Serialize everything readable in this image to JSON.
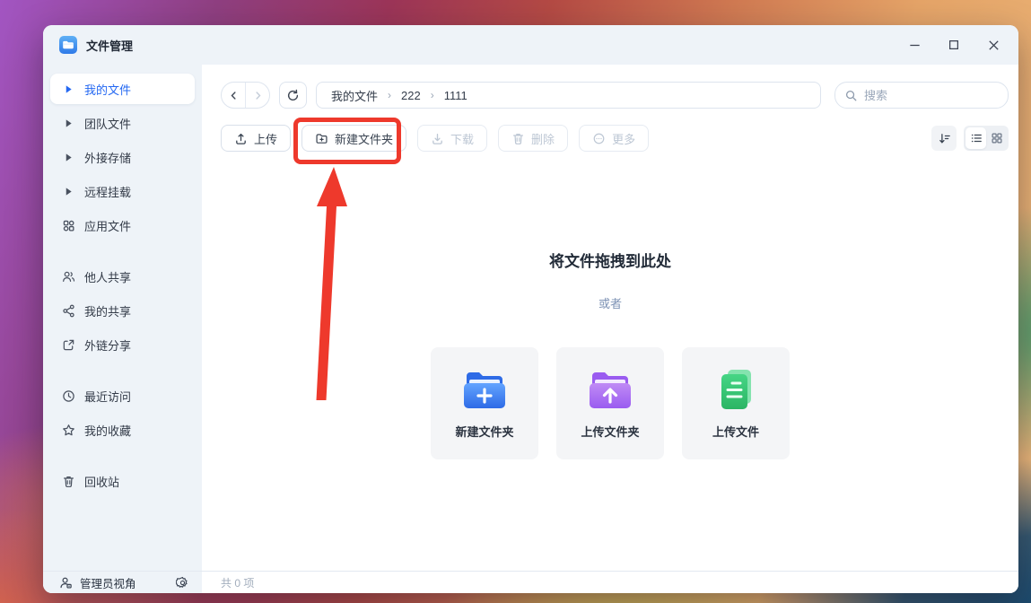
{
  "window": {
    "title": "文件管理"
  },
  "sidebar": {
    "items": [
      {
        "label": "我的文件",
        "icon": "caret-right-icon",
        "selected": true
      },
      {
        "label": "团队文件",
        "icon": "caret-right-icon",
        "selected": false
      },
      {
        "label": "外接存储",
        "icon": "caret-right-icon",
        "selected": false
      },
      {
        "label": "远程挂载",
        "icon": "caret-right-icon",
        "selected": false
      },
      {
        "label": "应用文件",
        "icon": "apps-icon",
        "selected": false
      },
      {
        "label": "他人共享",
        "icon": "shared-users-icon",
        "selected": false
      },
      {
        "label": "我的共享",
        "icon": "share-nodes-icon",
        "selected": false
      },
      {
        "label": "外链分享",
        "icon": "external-share-icon",
        "selected": false
      },
      {
        "label": "最近访问",
        "icon": "clock-icon",
        "selected": false
      },
      {
        "label": "我的收藏",
        "icon": "star-icon",
        "selected": false
      },
      {
        "label": "回收站",
        "icon": "trash-icon",
        "selected": false
      }
    ],
    "footer": {
      "label": "管理员视角",
      "icon": "admin-user-icon",
      "settings_icon": "gear-icon"
    }
  },
  "toolbar": {
    "breadcrumb": {
      "items": [
        "我的文件",
        "222",
        "1111"
      ],
      "separator": "›"
    },
    "search": {
      "placeholder": "搜索",
      "icon": "search-icon"
    }
  },
  "actions": {
    "buttons": [
      {
        "label": "上传",
        "icon": "upload-icon",
        "enabled": true
      },
      {
        "label": "新建文件夹",
        "icon": "new-folder-icon",
        "enabled": true,
        "annotated": true
      },
      {
        "label": "下载",
        "icon": "download-icon",
        "enabled": false
      },
      {
        "label": "删除",
        "icon": "delete-icon",
        "enabled": false
      },
      {
        "label": "更多",
        "icon": "more-circle-icon",
        "enabled": false
      }
    ],
    "view": {
      "active_view": "list",
      "sort_icon": "sort-descending-icon",
      "list_icon": "list-view-icon",
      "grid_icon": "grid-view-icon"
    }
  },
  "empty_state": {
    "drop_hint": "将文件拖拽到此处",
    "or_text": "或者",
    "cards": [
      {
        "label": "新建文件夹",
        "icon": "folder-plus-icon",
        "color": "#2e6be6"
      },
      {
        "label": "上传文件夹",
        "icon": "folder-upload-icon",
        "color": "#9a5cf0"
      },
      {
        "label": "上传文件",
        "icon": "file-upload-icon",
        "color": "#2bb564"
      }
    ]
  },
  "statusbar": {
    "item_count": "共 0 项"
  },
  "annotation": {
    "type": "red-box-and-arrow",
    "target": "新建文件夹",
    "color": "#ee392c"
  },
  "colors": {
    "accent": "#2468f2",
    "chrome_bg": "#eef3f8",
    "disabled_text": "#bdc7d4",
    "annotation": "#ee392c"
  }
}
